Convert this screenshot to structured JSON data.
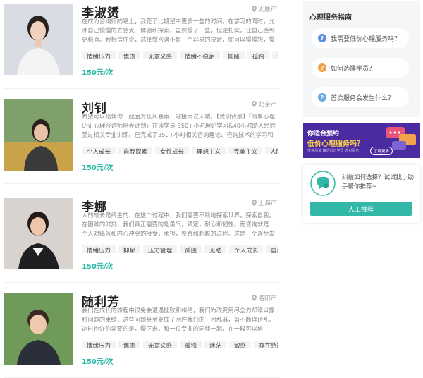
{
  "counselors": [
    {
      "name": "李淑赟",
      "city": "太原市",
      "bio": "在成为咨询师的路上，我花了比期望中更多一些的时间，在学习的同时，允许自己慢慢的去感受、体验和探索。虽然慢了一些，但更扎实，让自己感到更稳固。我相信你说，选择做咨询不是一个容易的决定，你可以慢慢想，慢",
      "tags": [
        "情绪压力",
        "焦虑",
        "无意义感",
        "情绪不稳定",
        "抑郁",
        "孤独",
        "无"
      ],
      "price": "150元/次",
      "photo_bg": "#d9dde3"
    },
    {
      "name": "刘钊",
      "city": "北京市",
      "bio": "希望可以陪伴你一起面对狂风暴雨，迎接雨过天晴。【受训背景】「简单心理Uni-心理咨询师培养计划」在读学员 350+小时理论学习&40小时助人经验受过相关专业训练。已完成了350+小时相关咨询理论、咨询技术的学习和练",
      "tags": [
        "个人成长",
        "自我探索",
        "女性成长",
        "理想主义",
        "完美主义",
        "人际"
      ],
      "price": "150元/次",
      "photo_bg": "#7fa06a"
    },
    {
      "name": "李娜",
      "city": "上海市",
      "bio": "人的成长是终生的，在这个过程中，我们需要不断地探索世界，探索自我。在困难的时刻，我们真正需要的是勇气，镇定，耐心和韧性。而咨询就是一个人对痛苦和内心冲突的接受，承担，整合和超越的过程。这是一个逐步发",
      "tags": [
        "情绪压力",
        "抑郁",
        "压力管理",
        "孤独",
        "无助",
        "个人成长",
        "自我"
      ],
      "price": "150元/次",
      "photo_bg": "#d8d3cf"
    },
    {
      "name": "随利芳",
      "city": "洛阳市",
      "bio": "我们在成长的旅程中很免会遭遇挫败和纠结，我们为改变用尽全力却难以挣脱问题的束缚，这些问题甚至变成了困住我们的一团乱麻，剪不断理还乱。这时也许你需要的是，慢下来，和一位专业的同伴一起，在一段可以信",
      "tags": [
        "情绪压力",
        "焦虑",
        "无意义感",
        "孤独",
        "迷茫",
        "敏感",
        "存在感缺"
      ],
      "price": "150元/次",
      "photo_bg": "#6f9a5a"
    }
  ],
  "sidebar": {
    "guide_title": "心理服务指南",
    "faqs": [
      {
        "text": "我需要低价心理服务吗？",
        "icon": "question-icon",
        "color": "#5b8ee6"
      },
      {
        "text": "如何选择学员？",
        "icon": "question-icon",
        "color": "#f0a24a"
      },
      {
        "text": "首次服务会发生什么？",
        "icon": "question-icon",
        "color": "#6da7e0"
      }
    ],
    "banner": {
      "line1": "你适合预约",
      "line2": "低价心理服务吗？",
      "line3": "快速测试 精选低价学员 选对服务",
      "button": "了解更多"
    },
    "helper": {
      "text": "纠结如何选择？试试找小助手帮你推荐~",
      "button": "人工推荐"
    }
  }
}
